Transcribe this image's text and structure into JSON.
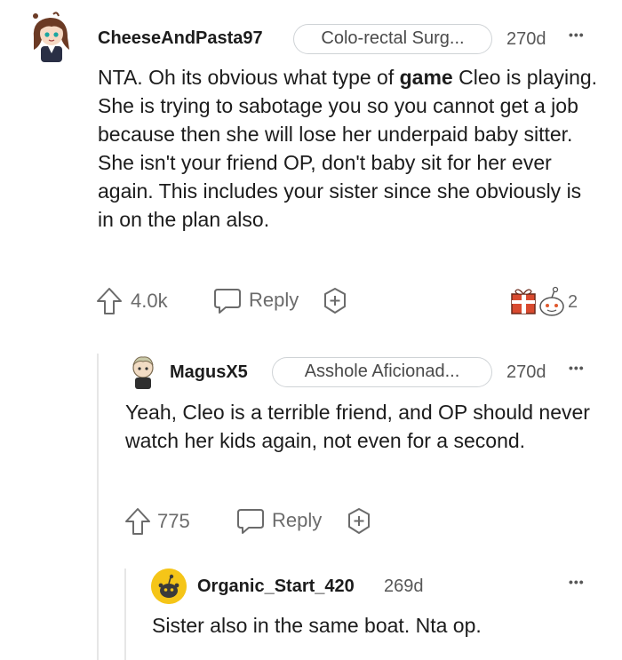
{
  "comments": [
    {
      "username": "CheeseAndPasta97",
      "flair": "Colo-rectal Surg...",
      "age": "270d",
      "more": "•••",
      "body_pre": "NTA. Oh its obvious what type of ",
      "body_bold": "game",
      "body_post": " Cleo is playing. She is trying to sabotage you so you cannot get a job because then she will lose her underpaid baby sitter. She isn't your friend OP, don't baby sit for her ever again. This includes your sister since she obviously is in on the plan also.",
      "votes": "4.0k",
      "reply_label": "Reply",
      "award_count": "2"
    },
    {
      "username": "MagusX5",
      "flair": "Asshole Aficionad...",
      "age": "270d",
      "more": "•••",
      "body": "Yeah, Cleo is a terrible friend, and OP should never watch her kids again, not even for a second.",
      "votes": "775",
      "reply_label": "Reply"
    },
    {
      "username": "Organic_Start_420",
      "age": "269d",
      "more": "•••",
      "body": "Sister also in the same boat. Nta op."
    }
  ],
  "icons": [
    "upvote-icon",
    "reply-bubble-icon",
    "award-plus-icon",
    "gift-award-icon",
    "snoo-award-icon"
  ],
  "colors": {
    "text": "#1c1c1c",
    "meta": "#575757",
    "action": "#6b6b6b",
    "border": "#cfd3d6",
    "thread_line": "#e6e6e6",
    "snoo_yellow": "#f5c518"
  }
}
